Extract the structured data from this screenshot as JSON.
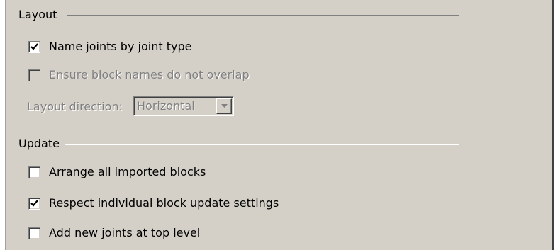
{
  "layout_group": {
    "title": "Layout",
    "name_joints": {
      "label": "Name joints by joint type",
      "checked": true,
      "enabled": true
    },
    "ensure_names": {
      "label": "Ensure block names do not overlap",
      "checked": false,
      "enabled": false
    },
    "layout_direction": {
      "label": "Layout direction:",
      "value": "Horizontal",
      "enabled": false,
      "arrow_icon": "chevron-down-icon"
    }
  },
  "update_group": {
    "title": "Update",
    "arrange_all": {
      "label": "Arrange all imported blocks",
      "checked": false,
      "enabled": true
    },
    "respect_individual": {
      "label": "Respect individual block update settings",
      "checked": true,
      "enabled": true
    },
    "add_new_joints": {
      "label": "Add new joints at top level",
      "checked": false,
      "enabled": true
    }
  },
  "colors": {
    "panel_bg": "#d4d0c8",
    "disabled_text": "#808080",
    "check_mark": "#000000"
  }
}
